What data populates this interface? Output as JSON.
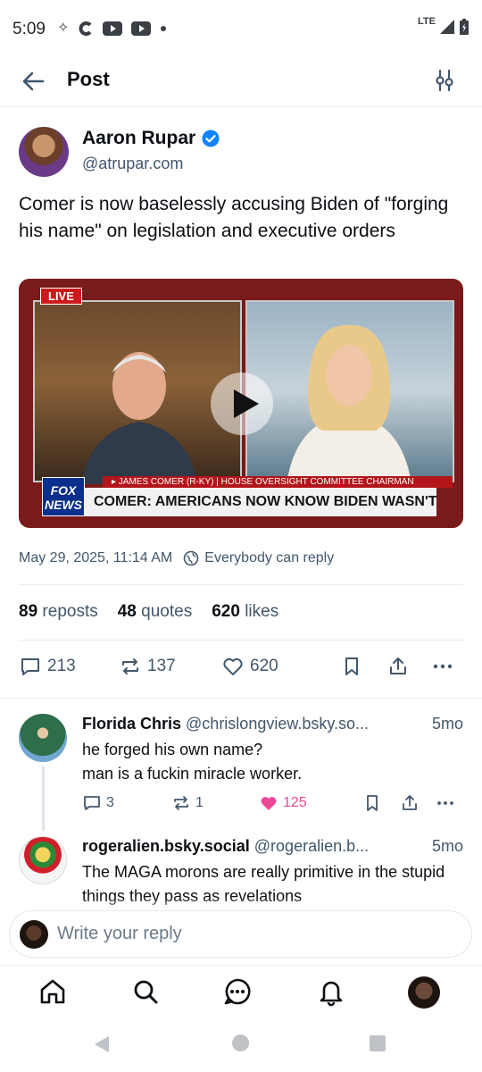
{
  "status_bar": {
    "time": "5:09",
    "network": "LTE"
  },
  "header": {
    "title": "Post"
  },
  "post": {
    "author_name": "Aaron Rupar",
    "author_handle": "@atrupar.com",
    "text": "Comer is now baselessly accusing Biden of \"forging his name\" on legislation and executive orders",
    "media": {
      "live_badge": "LIVE",
      "chyron_top": "▸ JAMES COMER (R-KY) | HOUSE OVERSIGHT COMMITTEE CHAIRMAN",
      "chyron_main": "COMER: AMERICANS NOW KNOW BIDEN WASN'T FIT",
      "network_logo": "FOX NEWS"
    },
    "timestamp": "May 29, 2025, 11:14 AM",
    "reply_setting": "Everybody can reply",
    "stats": {
      "reposts_count": "89",
      "reposts_label": "reposts",
      "quotes_count": "48",
      "quotes_label": "quotes",
      "likes_count": "620",
      "likes_label": "likes"
    },
    "actions": {
      "replies": "213",
      "reposts": "137",
      "likes": "620"
    }
  },
  "replies": [
    {
      "name": "Florida Chris",
      "handle": "@chrislongview.bsky.so...",
      "time": "5mo",
      "text_line1": "he forged his own name?",
      "text_line2": "man is a fuckin miracle worker.",
      "reply_count": "3",
      "repost_count": "1",
      "like_count": "125"
    },
    {
      "name": "rogeralien.bsky.social",
      "handle": "@rogeralien.b...",
      "time": "5mo",
      "text": "The MAGA morons are really primitive in the stupid things they pass as revelations"
    }
  ],
  "composer": {
    "placeholder": "Write your reply"
  },
  "colors": {
    "accent": "#1083fe",
    "like": "#ec4899",
    "muted": "#42576c"
  }
}
